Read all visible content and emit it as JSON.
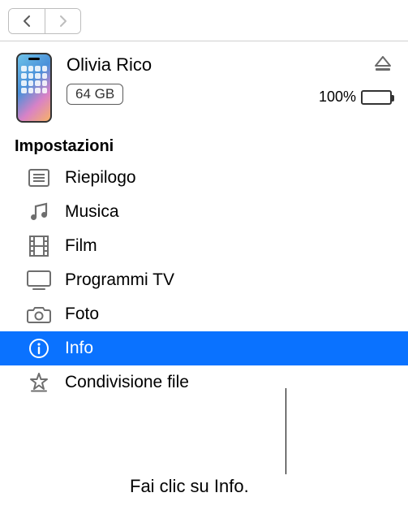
{
  "device": {
    "name": "Olivia Rico",
    "capacity": "64 GB",
    "battery_percent": "100%"
  },
  "sidebar": {
    "section_title": "Impostazioni",
    "items": [
      {
        "label": "Riepilogo",
        "icon": "list-icon",
        "selected": false
      },
      {
        "label": "Musica",
        "icon": "music-icon",
        "selected": false
      },
      {
        "label": "Film",
        "icon": "film-icon",
        "selected": false
      },
      {
        "label": "Programmi TV",
        "icon": "tv-icon",
        "selected": false
      },
      {
        "label": "Foto",
        "icon": "camera-icon",
        "selected": false
      },
      {
        "label": "Info",
        "icon": "info-icon",
        "selected": true
      },
      {
        "label": "Condivisione file",
        "icon": "apps-icon",
        "selected": false
      }
    ]
  },
  "callout": "Fai clic su Info."
}
